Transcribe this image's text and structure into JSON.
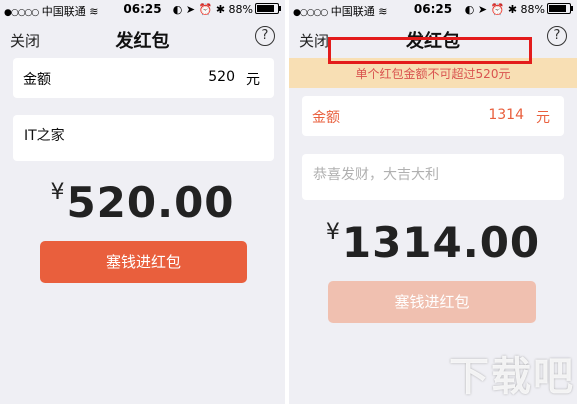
{
  "left": {
    "status": {
      "carrier": "中国联通",
      "time": "06:25",
      "battery": "88%"
    },
    "nav": {
      "close": "关闭",
      "title": "发红包",
      "help": "?"
    },
    "amount": {
      "label": "金额",
      "value": "520",
      "unit": "元"
    },
    "note": "IT之家",
    "big_amount": {
      "currency": "¥",
      "value": "520.00"
    },
    "button": "塞钱进红包"
  },
  "right": {
    "status": {
      "carrier": "中国联通",
      "time": "06:25",
      "battery": "88%"
    },
    "nav": {
      "close": "关闭",
      "title": "发红包",
      "help": "?"
    },
    "warning": "单个红包金额不可超过520元",
    "amount": {
      "label": "金额",
      "value": "1314",
      "unit": "元"
    },
    "note_placeholder": "恭喜发财，大吉大利",
    "big_amount": {
      "currency": "¥",
      "value": "1314.00"
    },
    "button": "塞钱进红包"
  },
  "watermark": "下载吧",
  "colors": {
    "accent": "#e95f3d",
    "accent_disabled": "#f0c0b0",
    "warning_bg": "#f8dfb4",
    "warning_text": "#d9534f",
    "highlight_frame": "#e31b1b"
  }
}
